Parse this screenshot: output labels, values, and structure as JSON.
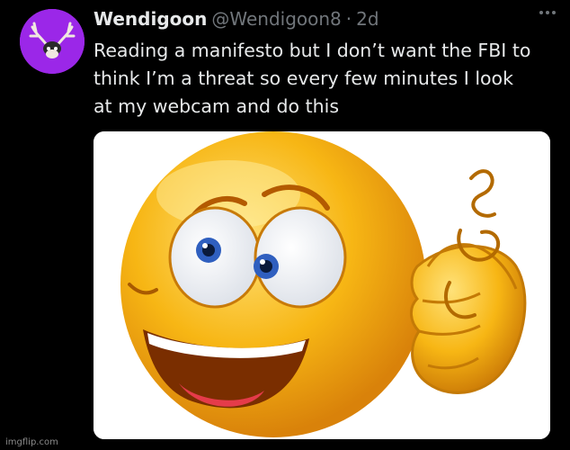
{
  "tweet": {
    "display_name": "Wendigoon",
    "handle": "@Wendigoon8",
    "separator": "·",
    "time": "2d",
    "text": "Reading a manifesto but I don’t want the FBI to\nthink I’m a threat so every few minutes I look\nat my webcam and do this",
    "avatar_color": "#9b27e8",
    "more_icon": "more-horizontal-icon"
  },
  "media": {
    "subject": "crazy-emoji-icon",
    "emoji_color": "#f7b614"
  },
  "watermark": "imgflip.com"
}
